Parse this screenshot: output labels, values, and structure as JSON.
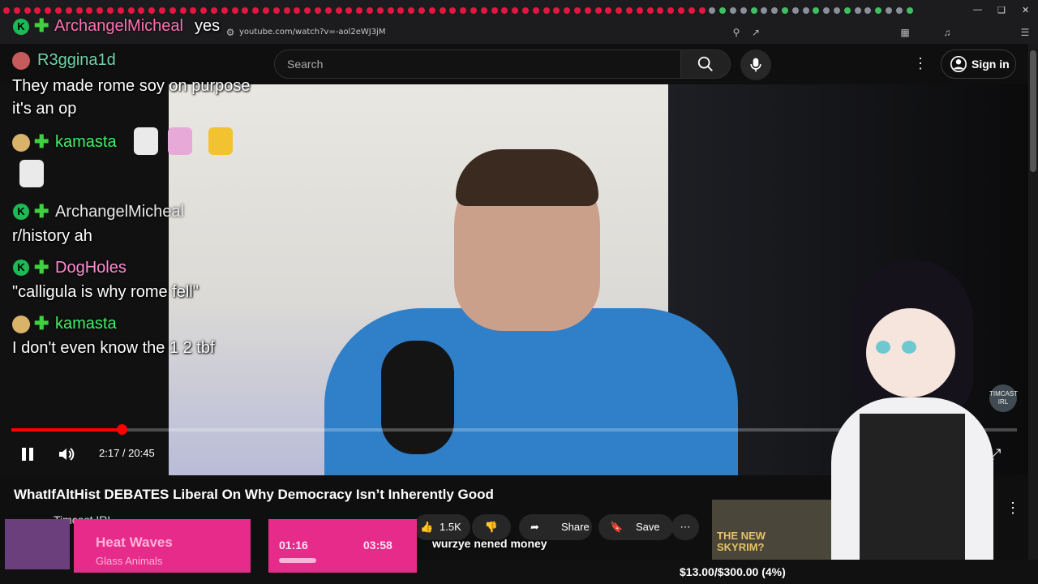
{
  "browser": {
    "url": "youtube.com/watch?v=-aol2eWJ3jM"
  },
  "youtube": {
    "search_placeholder": "Search",
    "sign_in": "Sign in"
  },
  "chat": {
    "top": {
      "user": "ArchangelMicheal",
      "message": "yes"
    },
    "messages": [
      {
        "user": "R3ggina1d",
        "text": "They made rome soy on purpose it's an op"
      },
      {
        "user": "kamasta",
        "text": ""
      },
      {
        "user": "ArchangelMicheal",
        "text": "r/history ah"
      },
      {
        "user": "DogHoles",
        "text": "\"calligula is why rome fell\""
      },
      {
        "user": "kamasta",
        "text": "I don't even know the 1 2 tbf"
      }
    ],
    "bottom_line": "wurzye nened money"
  },
  "colors": {
    "r3ggina": "#6fd3a8",
    "kamasta": "#3ff26a",
    "archangel": "#ff6fb3",
    "doghole": "#ff8ad0",
    "red": "#ff0000"
  },
  "player": {
    "time": "2:17 / 20:45",
    "progress": 0.11,
    "watermark": "TIMCAST IRL"
  },
  "video": {
    "title": "WhatIfAltHist DEBATES Liberal On Why Democracy Isn’t Inherently Good",
    "channel": "Timcast IRL",
    "likes": "1.5K",
    "share": "Share",
    "save": "Save"
  },
  "ad": {
    "line1": "THE NEW",
    "line2": "SKYRIM?"
  },
  "music": {
    "title": "Heat Waves",
    "artist": "Glass Animals",
    "elapsed": "01:16",
    "total": "03:58"
  },
  "goal": "$13.00/$300.00 (4%)"
}
